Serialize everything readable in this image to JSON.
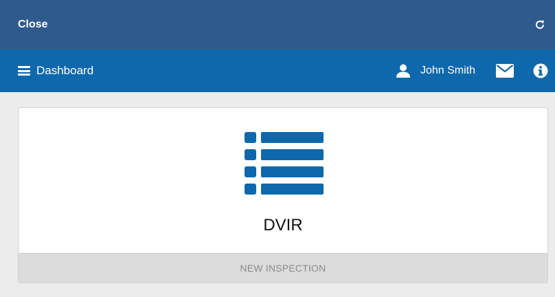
{
  "topbar": {
    "close_label": "Close",
    "refresh_icon": "refresh-icon"
  },
  "navbar": {
    "menu_icon": "hamburger-menu-icon",
    "dashboard_label": "Dashboard",
    "user_icon": "user-icon",
    "user_name": "John Smith",
    "mail_icon": "envelope-icon",
    "info_icon": "info-icon"
  },
  "card": {
    "icon": "list-icon",
    "title": "DVIR",
    "action_label": "NEW INSPECTION"
  },
  "colors": {
    "topbar_bg": "#2f5a8c",
    "navbar_bg": "#0f68ab",
    "accent": "#0f68ab",
    "page_bg": "#ececec"
  }
}
